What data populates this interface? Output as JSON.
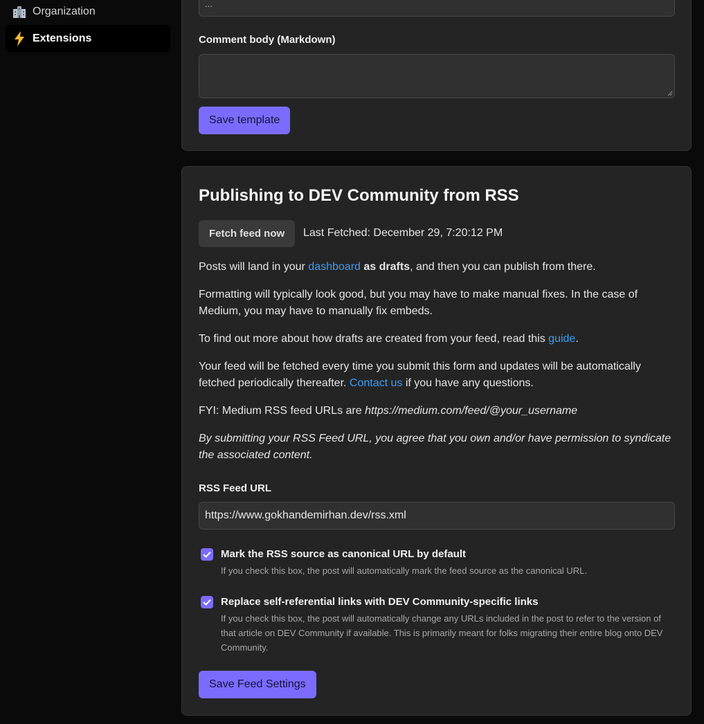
{
  "sidebar": {
    "items": [
      {
        "label": "Organization",
        "icon": "organization-icon"
      },
      {
        "label": "Extensions",
        "icon": "lightning-icon"
      }
    ]
  },
  "template_card": {
    "title_value": "...",
    "comment_label": "Comment body (Markdown)",
    "comment_value": "",
    "save_label": "Save template"
  },
  "rss": {
    "heading": "Publishing to DEV Community from RSS",
    "fetch_button": "Fetch feed now",
    "last_fetched": "Last Fetched: December 29, 7:20:12 PM",
    "p1": {
      "before": "Posts will land in your ",
      "link": "dashboard",
      "bold": "as drafts",
      "after": ", and then you can publish from there."
    },
    "p2": "Formatting will typically look good, but you may have to make manual fixes. In the case of Medium, you may have to manually fix embeds.",
    "p3": {
      "before": "To find out more about how drafts are created from your feed, read this ",
      "link": "guide",
      "after": "."
    },
    "p4": {
      "before": "Your feed will be fetched every time you submit this form and updates will be automatically fetched periodically thereafter. ",
      "link": "Contact us",
      "after": " if you have any questions."
    },
    "p5": {
      "before": "FYI: Medium RSS feed URLs are ",
      "italic": "https://medium.com/feed/@your_username"
    },
    "p6": "By submitting your RSS Feed URL, you agree that you own and/or have permission to syndicate the associated content.",
    "url_label": "RSS Feed URL",
    "url_value": "https://www.gokhandemirhan.dev/rss.xml",
    "canonical": {
      "checked": true,
      "label": "Mark the RSS source as canonical URL by default",
      "description": "If you check this box, the post will automatically mark the feed source as the canonical URL."
    },
    "selfref": {
      "checked": true,
      "label": "Replace self-referential links with DEV Community-specific links",
      "description": "If you check this box, the post will automatically change any URLs included in the post to refer to the version of that article on DEV Community if available. This is primarily meant for folks migrating their entire blog onto DEV Community."
    },
    "save_label": "Save Feed Settings"
  },
  "colors": {
    "accent": "#7b6cff",
    "link": "#3b9cf4",
    "card_bg": "#242424",
    "page_bg": "#0a0a0a"
  }
}
